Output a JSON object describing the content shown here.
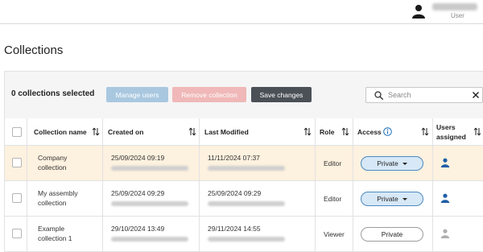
{
  "header": {
    "user_role": "User",
    "user_icon": "user-icon"
  },
  "page": {
    "title": "Collections"
  },
  "toolbar": {
    "selected_count": "0 collections selected",
    "manage_users_label": "Manage users",
    "remove_collection_label": "Remove collection",
    "save_changes_label": "Save changes",
    "search_placeholder": "Search",
    "search_value": ""
  },
  "table": {
    "columns": {
      "name": "Collection name",
      "created": "Created on",
      "modified": "Last Modified",
      "role": "Role",
      "access": "Access",
      "users_line1": "Users",
      "users_line2": "assigned"
    },
    "rows": [
      {
        "name_line1": "Company",
        "name_line2": "collection",
        "created": "25/09/2024 09:19",
        "modified": "11/11/2024 07:37",
        "role": "Editor",
        "access": "Private",
        "access_dropdown": true,
        "highlighted": true,
        "users_icon_color": "#1f5fa8"
      },
      {
        "name_line1": "My assembly",
        "name_line2": "collection",
        "created": "25/09/2024 09:29",
        "modified": "25/09/2024 09:29",
        "role": "Editor",
        "access": "Private",
        "access_dropdown": true,
        "highlighted": false,
        "users_icon_color": "#1f5fa8"
      },
      {
        "name_line1": "Example",
        "name_line2": "collection 1",
        "created": "29/10/2024 13:49",
        "modified": "29/11/2024 14:55",
        "role": "Viewer",
        "access": "Private",
        "access_dropdown": false,
        "highlighted": false,
        "users_icon_color": "#b0b0b0"
      }
    ]
  },
  "colors": {
    "primary_button": "#a9c8e0",
    "danger_button": "#f0b8b8",
    "dark_button": "#4b5057",
    "row_highlight": "#fdf1df",
    "access_active_bg": "#d7e8f7",
    "access_active_border": "#4d8ac2",
    "info_icon": "#1f6fb8"
  }
}
